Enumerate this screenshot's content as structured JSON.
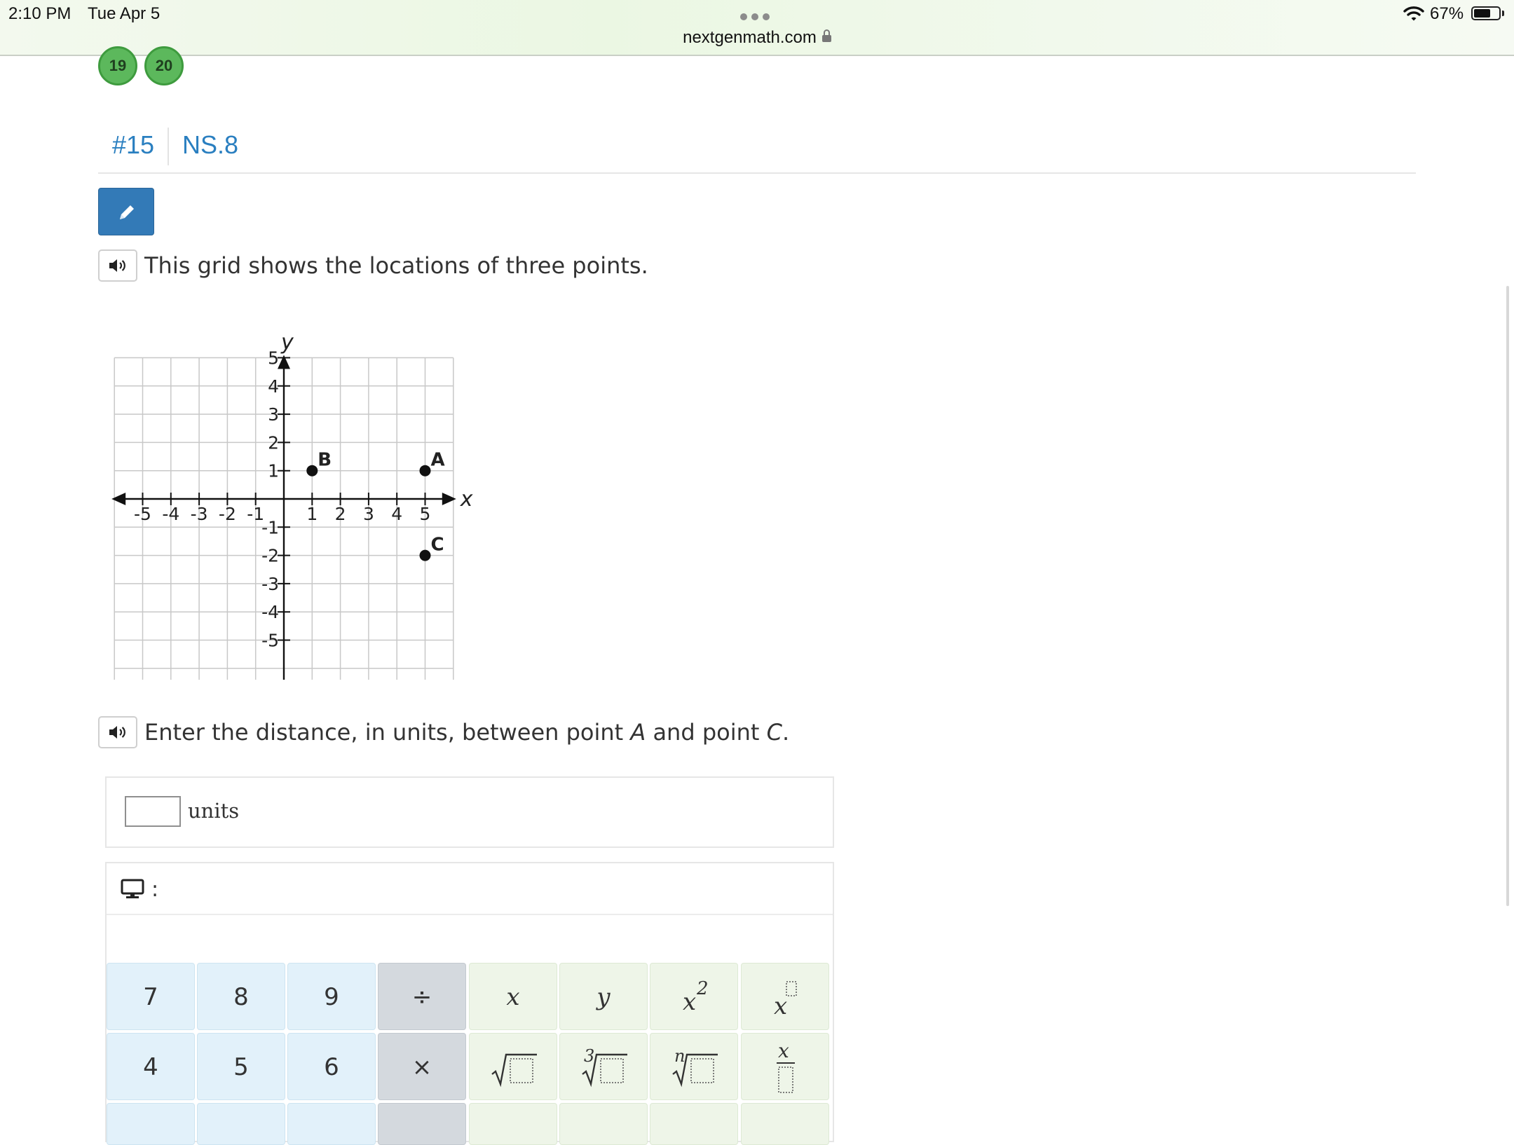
{
  "status_bar": {
    "time": "2:10 PM",
    "date": "Tue Apr 5",
    "url": "nextgenmath.com",
    "battery_percent": "67%",
    "battery_level": 0.67
  },
  "page_numbers": [
    "19",
    "20"
  ],
  "question": {
    "number": "#15",
    "standard": "NS.8",
    "prompt": "This grid shows the locations of three points.",
    "instruction_parts": [
      "Enter the distance, in units, between point ",
      "A",
      " and point ",
      "C",
      "."
    ]
  },
  "grid": {
    "x_axis_label": "x",
    "y_axis_label": "y",
    "x_ticks": [
      "-5",
      "-4",
      "-3",
      "-2",
      "-1",
      "1",
      "2",
      "3",
      "4",
      "5"
    ],
    "y_ticks": [
      "5",
      "4",
      "3",
      "2",
      "1",
      "-1",
      "-2",
      "-3",
      "-4",
      "-5"
    ],
    "x_range": [
      -6,
      6
    ],
    "y_range": [
      -7,
      5
    ],
    "points": [
      {
        "label": "A",
        "x": 5,
        "y": 1
      },
      {
        "label": "B",
        "x": 1,
        "y": 1
      },
      {
        "label": "C",
        "x": 5,
        "y": -2
      }
    ]
  },
  "answer": {
    "value": "",
    "unit": "units"
  },
  "keypad": {
    "header_icon": "monitor-icon",
    "header_colon": ":",
    "row1": [
      "7",
      "8",
      "9",
      "÷",
      "x",
      "y"
    ],
    "row2": [
      "4",
      "5",
      "6",
      "×"
    ],
    "power_base": "x",
    "power_exp": "2",
    "cube_root_index": "3",
    "nth_root_index": "n",
    "fraction_top": "x"
  },
  "colors": {
    "link_blue": "#2a7fc0",
    "button_blue": "#337ab7",
    "badge_green": "#5cb85c",
    "key_number_bg": "#e2f1fa",
    "key_operator_bg": "#d4d9de",
    "key_variable_bg": "#eef5e8"
  }
}
